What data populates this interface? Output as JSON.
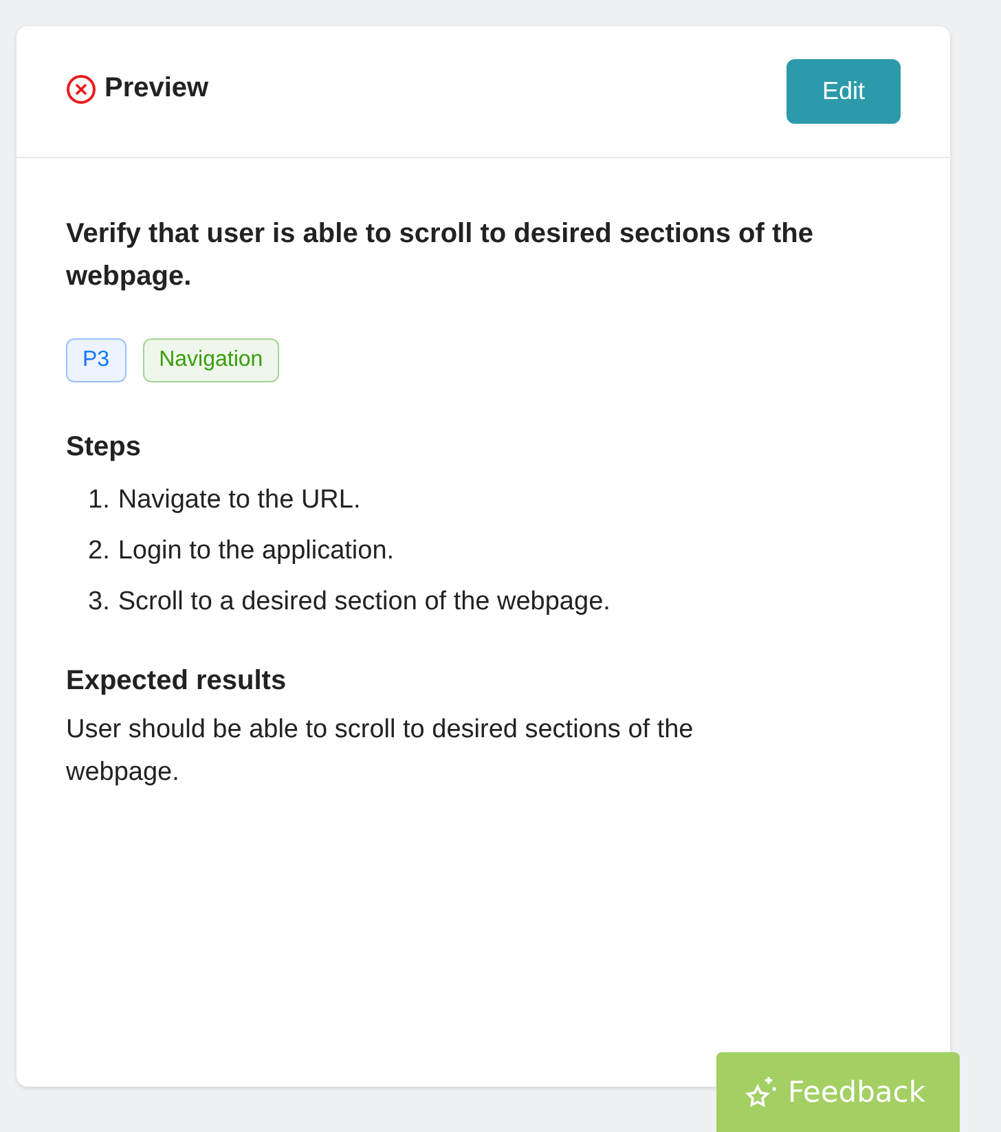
{
  "header": {
    "failed": true,
    "title": "Preview",
    "edit_button": "Edit"
  },
  "summary": "Verify that user is able to scroll to desired sections of the webpage.",
  "tags": [
    {
      "label": "P3",
      "color": "#1677ff"
    },
    {
      "label": "Navigation",
      "color": "#389e0d"
    }
  ],
  "steps": {
    "heading": "Steps",
    "items": [
      {
        "number": "1.",
        "text": "Navigate to the URL."
      },
      {
        "number": "2.",
        "text": "Login to the application."
      },
      {
        "number": "3.",
        "text": "Scroll to a desired section of the webpage."
      }
    ]
  },
  "expected": {
    "heading": "Expected results",
    "text": "User should be able to scroll to desired sections of the webpage."
  },
  "feedback_button": "Feedback"
}
